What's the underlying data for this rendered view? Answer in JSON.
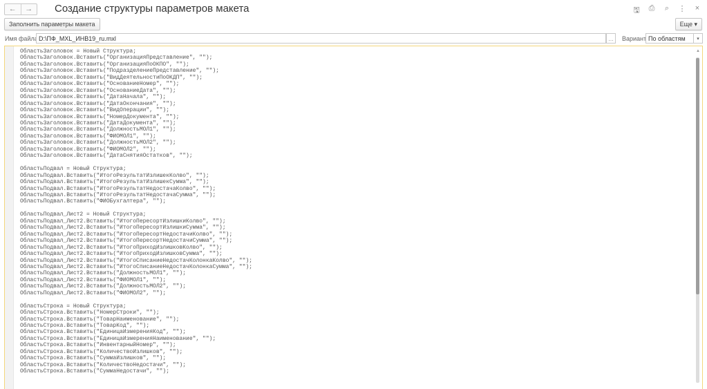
{
  "window": {
    "title": "Создание структуры параметров макета"
  },
  "nav": {
    "back_icon": "←",
    "forward_icon": "→"
  },
  "top_icons": {
    "save": "🖫",
    "print": "⎙",
    "preview": "⌕",
    "more": "⋮",
    "close": "×"
  },
  "toolbar": {
    "fill_button": "Заполнить параметры макета",
    "more_button": "Еще ▾"
  },
  "form": {
    "file_label": "Имя файла:",
    "file_value": "D:\\ПФ_MXL_ИНВ19_ru.mxl",
    "browse": "...",
    "variant_label": "Вариант:",
    "variant_value": "По областям",
    "variant_arrow": "▾"
  },
  "code_lines": [
    "ОбластьЗаголовок = Новый Структура;",
    "ОбластьЗаголовок.Вставить(\"ОрганизацияПредставление\", \"\");",
    "ОбластьЗаголовок.Вставить(\"ОрганизацияПоОКПО\", \"\");",
    "ОбластьЗаголовок.Вставить(\"ПодразделениеПредставление\", \"\");",
    "ОбластьЗаголовок.Вставить(\"ВидДеятельностиПоОКДП\", \"\");",
    "ОбластьЗаголовок.Вставить(\"ОснованиеНомер\", \"\");",
    "ОбластьЗаголовок.Вставить(\"ОснованиеДата\", \"\");",
    "ОбластьЗаголовок.Вставить(\"ДатаНачала\", \"\");",
    "ОбластьЗаголовок.Вставить(\"ДатаОкончания\", \"\");",
    "ОбластьЗаголовок.Вставить(\"ВидОперации\", \"\");",
    "ОбластьЗаголовок.Вставить(\"НомерДокумента\", \"\");",
    "ОбластьЗаголовок.Вставить(\"ДатаДокумента\", \"\");",
    "ОбластьЗаголовок.Вставить(\"ДолжностьМОЛ1\", \"\");",
    "ОбластьЗаголовок.Вставить(\"ФИОМОЛ1\", \"\");",
    "ОбластьЗаголовок.Вставить(\"ДолжностьМОЛ2\", \"\");",
    "ОбластьЗаголовок.Вставить(\"ФИОМОЛ2\", \"\");",
    "ОбластьЗаголовок.Вставить(\"ДатаСнятияОстатков\", \"\");",
    "",
    "ОбластьПодвал = Новый Структура;",
    "ОбластьПодвал.Вставить(\"ИтогоРезультатИзлишекКолво\", \"\");",
    "ОбластьПодвал.Вставить(\"ИтогоРезультатИзлишекСумма\", \"\");",
    "ОбластьПодвал.Вставить(\"ИтогоРезультатНедостачаКолво\", \"\");",
    "ОбластьПодвал.Вставить(\"ИтогоРезультатНедостачаСумма\", \"\");",
    "ОбластьПодвал.Вставить(\"ФИОБухгалтера\", \"\");",
    "",
    "ОбластьПодвал_Лист2 = Новый Структура;",
    "ОбластьПодвал_Лист2.Вставить(\"ИтогоПересортИзлишкиКолво\", \"\");",
    "ОбластьПодвал_Лист2.Вставить(\"ИтогоПересортИзлишкиСумма\", \"\");",
    "ОбластьПодвал_Лист2.Вставить(\"ИтогоПересортНедостачиКолво\", \"\");",
    "ОбластьПодвал_Лист2.Вставить(\"ИтогоПересортНедостачиСумма\", \"\");",
    "ОбластьПодвал_Лист2.Вставить(\"ИтогоПриходИзлишковКолво\", \"\");",
    "ОбластьПодвал_Лист2.Вставить(\"ИтогоПриходИзлишковСумма\", \"\");",
    "ОбластьПодвал_Лист2.Вставить(\"ИтогоСписаниеНедостачКолонкаКолво\", \"\");",
    "ОбластьПодвал_Лист2.Вставить(\"ИтогоСписаниеНедостачКолонкаСумма\", \"\");",
    "ОбластьПодвал_Лист2.Вставить(\"ДолжностьМОЛ1\", \"\");",
    "ОбластьПодвал_Лист2.Вставить(\"ФИОМОЛ1\", \"\");",
    "ОбластьПодвал_Лист2.Вставить(\"ДолжностьМОЛ2\", \"\");",
    "ОбластьПодвал_Лист2.Вставить(\"ФИОМОЛ2\", \"\");",
    "",
    "ОбластьСтрока = Новый Структура;",
    "ОбластьСтрока.Вставить(\"НомерСтроки\", \"\");",
    "ОбластьСтрока.Вставить(\"ТоварНаименование\", \"\");",
    "ОбластьСтрока.Вставить(\"ТоварКод\", \"\");",
    "ОбластьСтрока.Вставить(\"ЕдиницаИзмеренияКод\", \"\");",
    "ОбластьСтрока.Вставить(\"ЕдиницаИзмеренияНаименование\", \"\");",
    "ОбластьСтрока.Вставить(\"ИнвентарныйНомер\", \"\");",
    "ОбластьСтрока.Вставить(\"КоличествоИзлишков\", \"\");",
    "ОбластьСтрока.Вставить(\"СуммаИзлишков\", \"\");",
    "ОбластьСтрока.Вставить(\"КоличествоНедостачи\", \"\");",
    "ОбластьСтрока.Вставить(\"СуммаНедостачи\", \"\");"
  ]
}
